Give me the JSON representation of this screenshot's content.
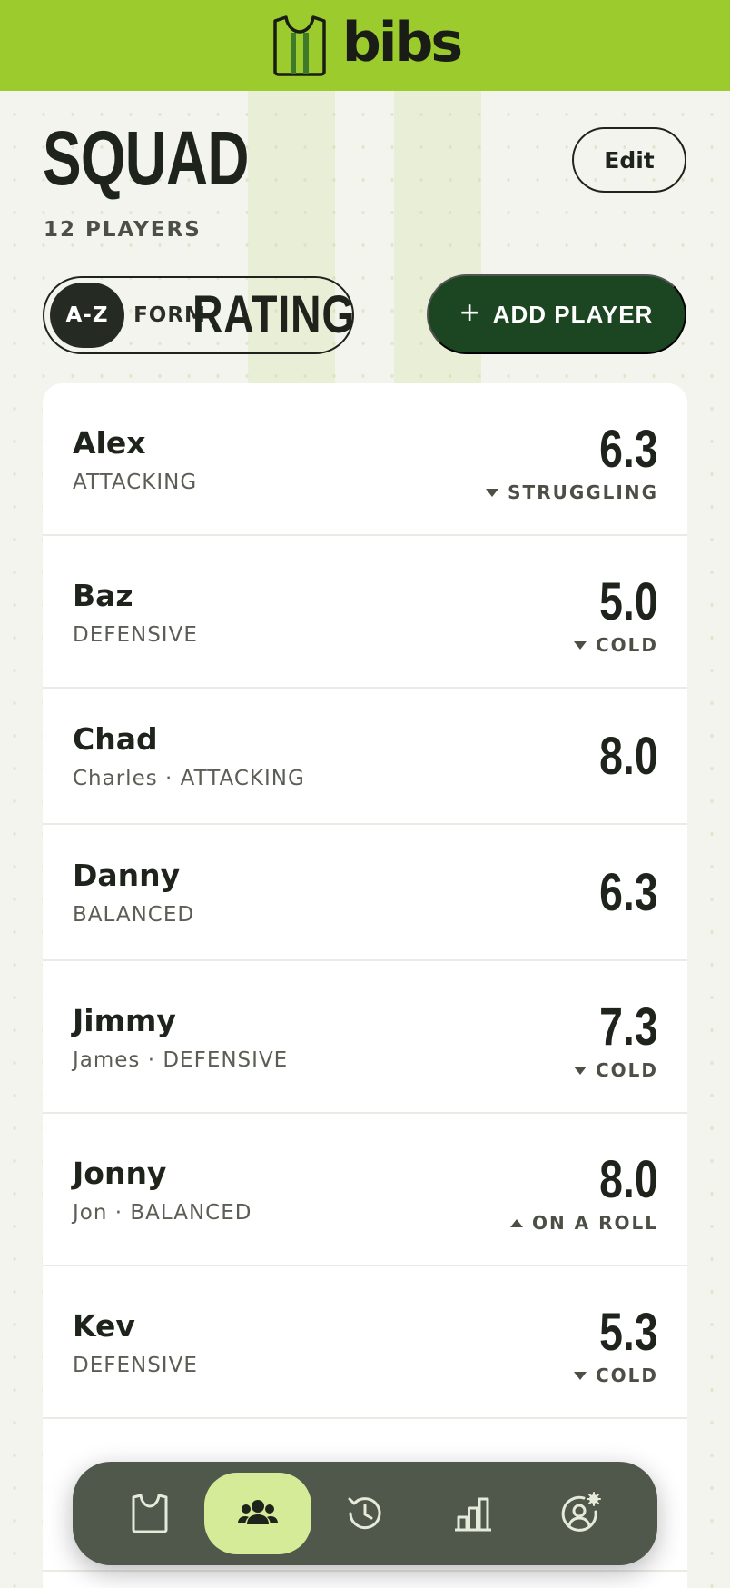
{
  "app": {
    "name": "bibs",
    "brand_color": "#9ccb2e",
    "accent_dark": "#1c4621"
  },
  "header": {
    "title": "SQUAD",
    "player_count": "12 PLAYERS",
    "edit_label": "Edit"
  },
  "sort": {
    "options": [
      "A-Z",
      "RATING",
      "FORM"
    ],
    "selected": "A-Z"
  },
  "add_player_label": "ADD PLAYER",
  "players": [
    {
      "name": "Alex",
      "sub": "ATTACKING",
      "rating": "6.3",
      "form": "STRUGGLING",
      "trend": "down"
    },
    {
      "name": "Baz",
      "sub": "DEFENSIVE",
      "rating": "5.0",
      "form": "COLD",
      "trend": "down"
    },
    {
      "name": "Chad",
      "sub": "Charles · ATTACKING",
      "rating": "8.0",
      "form": "",
      "trend": ""
    },
    {
      "name": "Danny",
      "sub": "BALANCED",
      "rating": "6.3",
      "form": "",
      "trend": ""
    },
    {
      "name": "Jimmy",
      "sub": "James · DEFENSIVE",
      "rating": "7.3",
      "form": "COLD",
      "trend": "down"
    },
    {
      "name": "Jonny",
      "sub": "Jon · BALANCED",
      "rating": "8.0",
      "form": "ON A ROLL",
      "trend": "up"
    },
    {
      "name": "Kev",
      "sub": "DEFENSIVE",
      "rating": "5.3",
      "form": "COLD",
      "trend": "down"
    }
  ],
  "nav": {
    "items": [
      {
        "icon": "bib-icon",
        "active": false
      },
      {
        "icon": "squad-icon",
        "active": true
      },
      {
        "icon": "history-icon",
        "active": false
      },
      {
        "icon": "stats-icon",
        "active": false
      },
      {
        "icon": "profile-settings-icon",
        "active": false
      }
    ]
  }
}
